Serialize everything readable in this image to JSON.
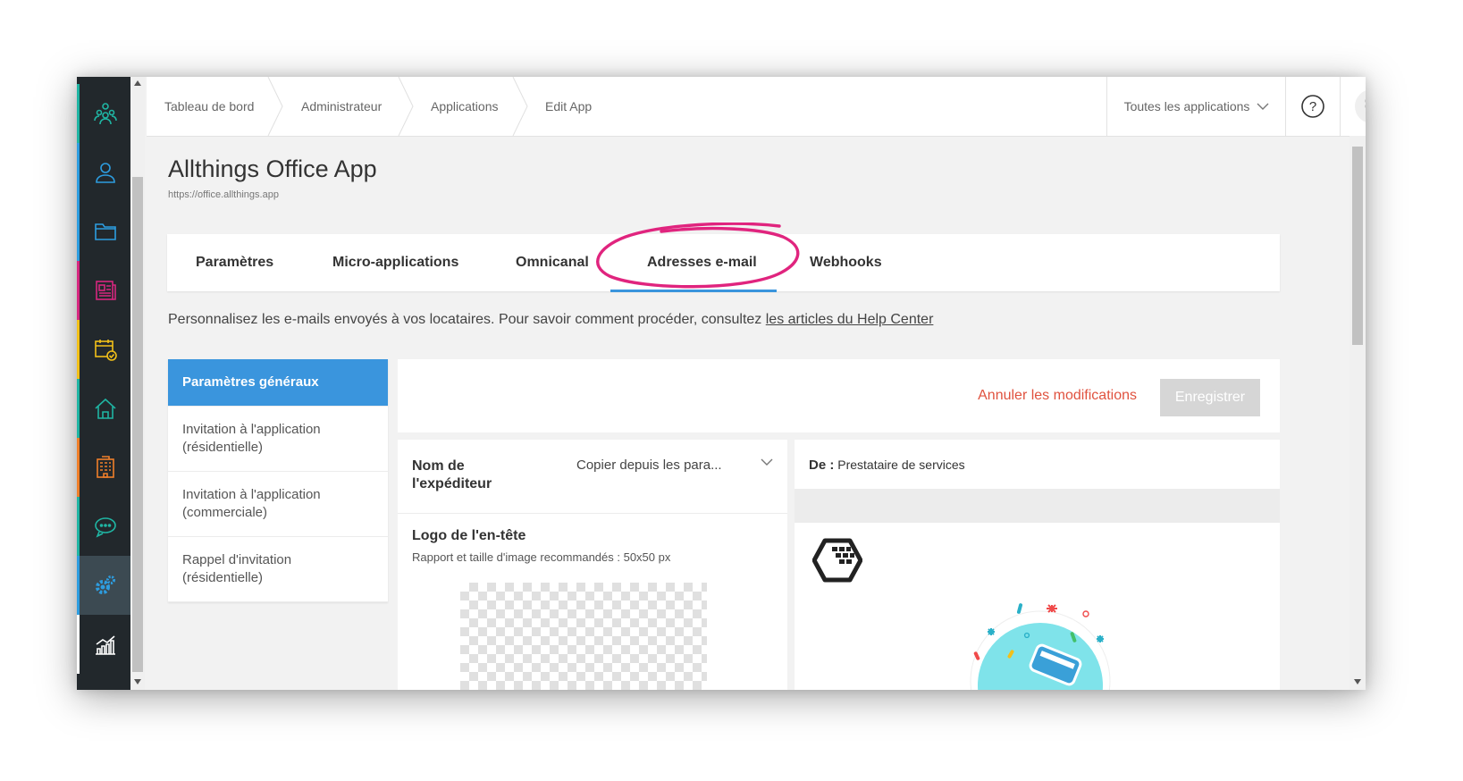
{
  "header": {
    "breadcrumbs": [
      "Tableau de bord",
      "Administrateur",
      "Applications",
      "Edit App"
    ],
    "app_selector": "Toutes les applications",
    "help_label": "?"
  },
  "page": {
    "title": "Allthings Office App",
    "url": "https://office.allthings.app"
  },
  "tabs": [
    {
      "label": "Paramètres"
    },
    {
      "label": "Micro-applications"
    },
    {
      "label": "Omnicanal"
    },
    {
      "label": "Adresses e-mail",
      "active": true
    },
    {
      "label": "Webhooks"
    }
  ],
  "intro": {
    "text": "Personnalisez les e-mails envoyés à vos locataires. Pour savoir comment procéder, consultez ",
    "link": "les articles du Help Center"
  },
  "templates": [
    {
      "label": "Paramètres généraux",
      "active": true
    },
    {
      "label": "Invitation à l'application (résidentielle)"
    },
    {
      "label": "Invitation à l'application (commerciale)"
    },
    {
      "label": "Rappel d'invitation (résidentielle)"
    }
  ],
  "actions": {
    "cancel": "Annuler les modifications",
    "save": "Enregistrer"
  },
  "form": {
    "sender_label": "Nom de l'expéditeur",
    "sender_value": "Copier depuis les para...",
    "logo_label": "Logo de l'en-tête",
    "logo_hint": "Rapport et taille d'image recommandés : 50x50 px"
  },
  "preview": {
    "from_label": "De :",
    "from_value": "Prestataire de services"
  },
  "sidebar": {
    "items": [
      {
        "icon": "community-icon",
        "accent": "#1fb5a3"
      },
      {
        "icon": "user-icon",
        "accent": "#2d9de0"
      },
      {
        "icon": "folder-icon",
        "accent": "#2d9de0"
      },
      {
        "icon": "newspaper-icon",
        "accent": "#d6277f"
      },
      {
        "icon": "calendar-check-icon",
        "accent": "#f2c019"
      },
      {
        "icon": "home-icon",
        "accent": "#1fb5a3"
      },
      {
        "icon": "building-icon",
        "accent": "#f07f2a"
      },
      {
        "icon": "chat-icon",
        "accent": "#1fb5a3"
      },
      {
        "icon": "gears-icon",
        "accent": "#2d9de0",
        "active": true
      },
      {
        "icon": "stats-icon",
        "accent": "#ffffff"
      }
    ]
  },
  "colors": {
    "primary": "#3a95dd",
    "danger": "#e0523f",
    "annotation": "#e0247e"
  }
}
